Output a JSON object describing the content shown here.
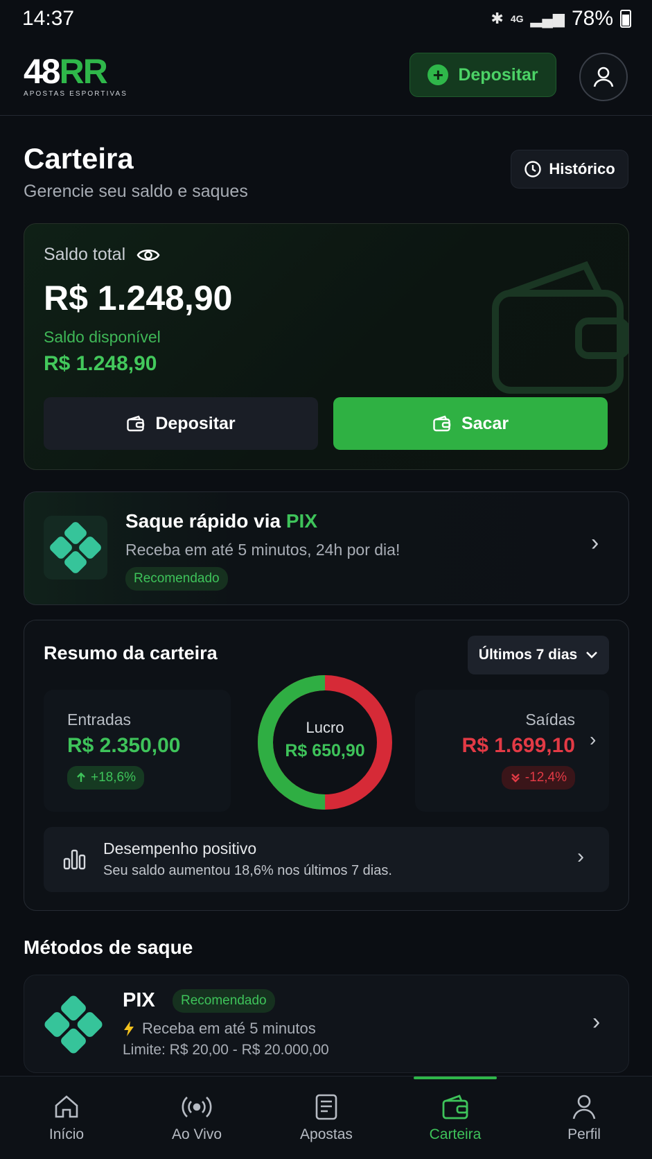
{
  "status_bar": {
    "time": "14:37",
    "battery": "78%"
  },
  "header": {
    "logo_main_white": "48",
    "logo_main_green": "RR",
    "logo_sub": "APOSTAS ESPORTIVAS",
    "deposit_label": "Depositar"
  },
  "page": {
    "title": "Carteira",
    "subtitle": "Gerencie seu saldo e saques",
    "history_label": "Histórico"
  },
  "balance": {
    "label": "Saldo total",
    "value": "R$ 1.248,90",
    "available_label": "Saldo disponível",
    "available_value": "R$ 1.248,90",
    "deposit_label": "Depositar",
    "withdraw_label": "Sacar"
  },
  "pix_quick": {
    "title_prefix": "Saque rápido via",
    "title_highlight": "PIX",
    "subtitle": "Receba em até 5 minutos, 24h por dia!",
    "badge": "Recomendado"
  },
  "summary": {
    "title": "Resumo da carteira",
    "period": "Últimos 7 dias",
    "entries_label": "Entradas",
    "entries_value": "R$ 2.350,00",
    "entries_change": "+18,6%",
    "exits_label": "Saídas",
    "exits_value": "R$ 1.699,10",
    "exits_change": "-12,4%",
    "profit_label": "Lucro",
    "profit_value": "R$ 650,90",
    "donut_green_fraction": 0.5,
    "performance_title": "Desempenho positivo",
    "performance_sub": "Seu saldo aumentou 18,6% nos últimos 7 dias."
  },
  "methods": {
    "title": "Métodos de saque",
    "items": [
      {
        "name": "PIX",
        "badge": "Recomendado",
        "line1": "Receba em até 5 minutos",
        "line2": "Limite: R$ 20,00 - R$ 20.000,00"
      }
    ]
  },
  "nav": {
    "items": [
      {
        "label": "Início",
        "icon": "home-icon"
      },
      {
        "label": "Ao Vivo",
        "icon": "live-icon"
      },
      {
        "label": "Apostas",
        "icon": "bets-icon"
      },
      {
        "label": "Carteira",
        "icon": "wallet-icon"
      },
      {
        "label": "Perfil",
        "icon": "profile-icon"
      }
    ],
    "active": "Carteira"
  },
  "colors": {
    "accent": "#2fb74a",
    "positive": "#3ec35a",
    "negative": "#e23a45",
    "background": "#0b0e13"
  }
}
